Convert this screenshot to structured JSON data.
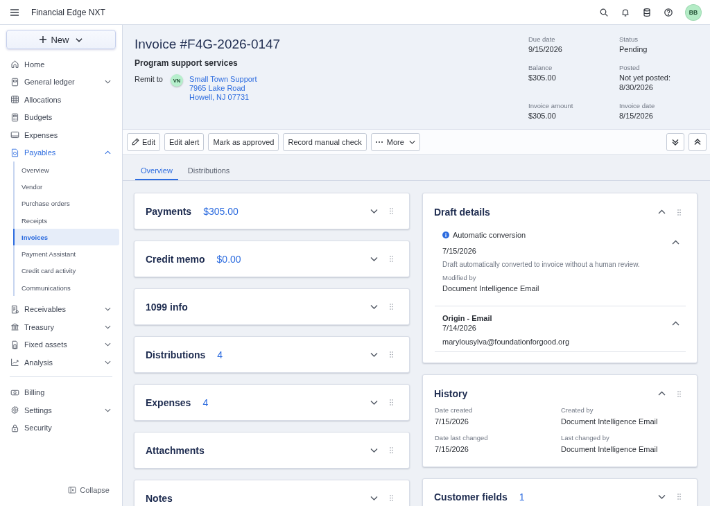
{
  "topbar": {
    "title": "Financial Edge NXT",
    "avatar": "BB"
  },
  "sidebar": {
    "new_button": "New",
    "items": [
      {
        "label": "Home",
        "kind": "link",
        "selected": false
      },
      {
        "label": "General ledger",
        "kind": "group",
        "expanded": false,
        "selected": false
      },
      {
        "label": "Allocations",
        "kind": "link",
        "selected": false
      },
      {
        "label": "Budgets",
        "kind": "link",
        "selected": false
      },
      {
        "label": "Expenses",
        "kind": "link",
        "selected": false
      },
      {
        "label": "Payables",
        "kind": "group",
        "expanded": true,
        "selected": true,
        "children": [
          {
            "label": "Overview",
            "selected": false
          },
          {
            "label": "Vendor",
            "selected": false
          },
          {
            "label": "Purchase orders",
            "selected": false
          },
          {
            "label": "Receipts",
            "selected": false
          },
          {
            "label": "Invoices",
            "selected": true
          },
          {
            "label": "Payment Assistant",
            "selected": false
          },
          {
            "label": "Credit card activity",
            "selected": false
          },
          {
            "label": "Communications",
            "selected": false
          }
        ]
      },
      {
        "label": "Receivables",
        "kind": "group",
        "expanded": false,
        "selected": false
      },
      {
        "label": "Treasury",
        "kind": "group",
        "expanded": false,
        "selected": false
      },
      {
        "label": "Fixed assets",
        "kind": "group",
        "expanded": false,
        "selected": false
      },
      {
        "label": "Analysis",
        "kind": "group",
        "expanded": false,
        "selected": false
      }
    ],
    "bottom_items": [
      {
        "label": "Billing",
        "kind": "link",
        "selected": false
      },
      {
        "label": "Settings",
        "kind": "group",
        "expanded": false,
        "selected": false
      },
      {
        "label": "Security",
        "kind": "link",
        "selected": false
      }
    ],
    "collapse": "Collapse"
  },
  "invoice": {
    "title": "Invoice #F4G-2026-0147",
    "description": "Program support services",
    "remit": {
      "label": "Remit to",
      "initials": "VN",
      "lines": [
        "Small Town Support",
        "7965 Lake Road",
        "Howell, NJ 07731"
      ]
    },
    "fields": [
      {
        "label": "Due date",
        "value": "9/15/2026"
      },
      {
        "label": "Status",
        "value": "Pending"
      },
      {
        "label": "Balance",
        "value": "$305.00"
      },
      {
        "label": "Posted",
        "value": "Not yet posted: 8/30/2026"
      },
      {
        "label": "Invoice amount",
        "value": "$305.00"
      },
      {
        "label": "Invoice date",
        "value": "8/15/2026"
      }
    ]
  },
  "toolbar": {
    "actions": [
      {
        "kind": "edit",
        "label": "Edit"
      },
      {
        "kind": "plain",
        "label": "Edit alert"
      },
      {
        "kind": "plain",
        "label": "Mark as approved"
      },
      {
        "kind": "plain",
        "label": "Record manual check"
      },
      {
        "kind": "menu",
        "label": "More"
      }
    ]
  },
  "tabs": [
    {
      "label": "Overview",
      "selected": true
    },
    {
      "label": "Distributions",
      "selected": false
    }
  ],
  "cards_left": [
    {
      "kind": "summary",
      "title": "Payments",
      "value": "$305.00",
      "expanded": false
    },
    {
      "kind": "summary",
      "title": "Credit memo",
      "value": "$0.00",
      "expanded": false
    },
    {
      "kind": "summary",
      "title": "1099 info",
      "expanded": false
    },
    {
      "kind": "summary",
      "title": "Distributions",
      "value": "4",
      "expanded": false
    },
    {
      "kind": "summary",
      "title": "Expenses",
      "value": "4",
      "expanded": false
    },
    {
      "kind": "summary",
      "title": "Attachments",
      "expanded": false
    },
    {
      "kind": "summary",
      "title": "Notes",
      "expanded": false
    }
  ],
  "cards_right": [
    {
      "kind": "draft",
      "title": "Draft details",
      "expanded": true,
      "sections": [
        {
          "kind": "conversion",
          "title": "Automatic conversion",
          "date": "7/15/2026",
          "description": "Draft automatically converted to invoice without a human review.",
          "modified_label": "Modified by",
          "modified_by": "Document Intelligence Email",
          "expanded": true
        },
        {
          "kind": "origin",
          "title": "Origin - Email",
          "date": "7/14/2026",
          "detail": "marylousylva@foundationforgood.org",
          "expanded": true
        }
      ]
    },
    {
      "kind": "history",
      "title": "History",
      "expanded": true,
      "fields": [
        {
          "label": "Date created",
          "value": "7/15/2026"
        },
        {
          "label": "Created by",
          "value": "Document Intelligence Email"
        },
        {
          "label": "Date last changed",
          "value": "7/15/2026"
        },
        {
          "label": "Last changed by",
          "value": "Document Intelligence Email"
        }
      ]
    },
    {
      "kind": "summary",
      "title": "Customer fields",
      "value": "1",
      "expanded": false
    }
  ]
}
